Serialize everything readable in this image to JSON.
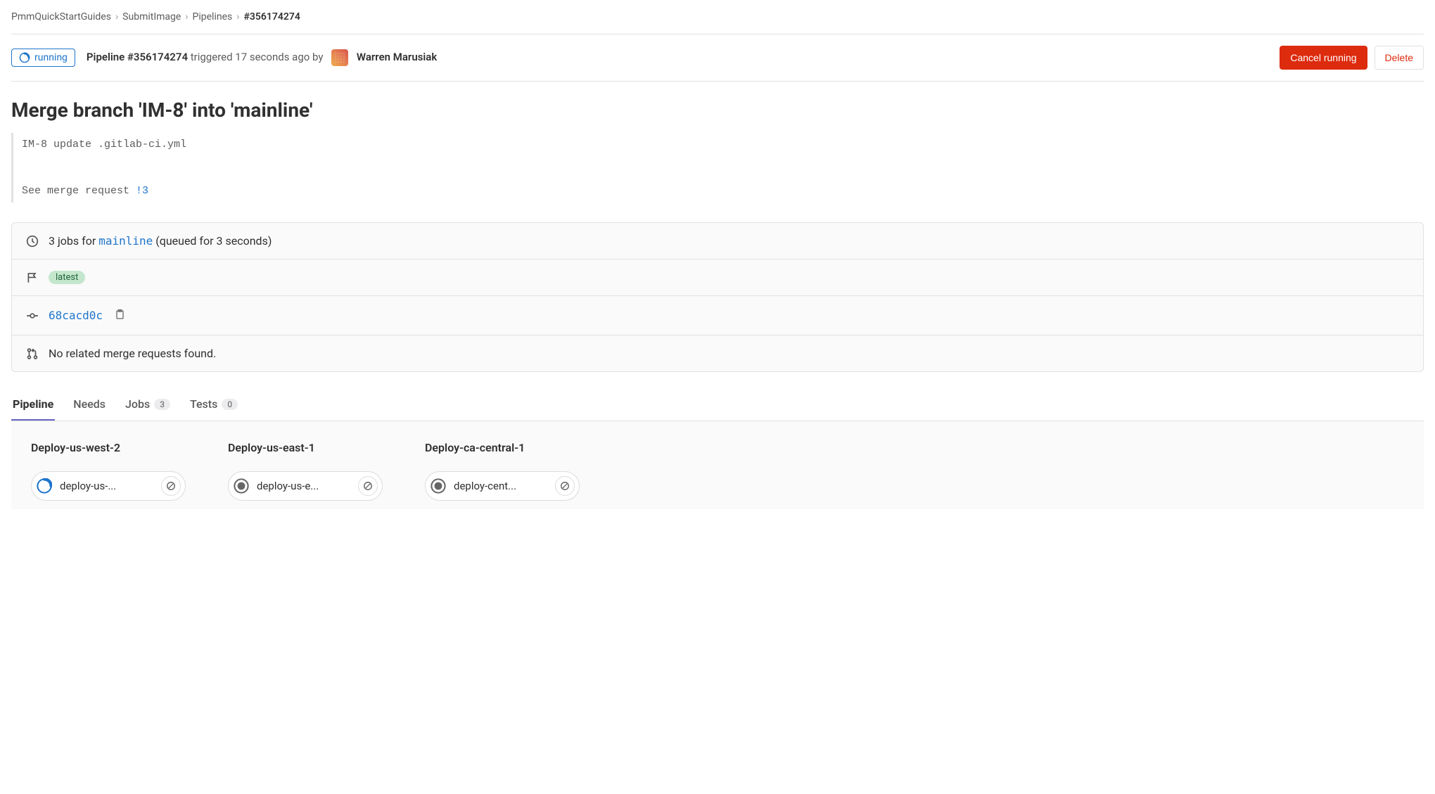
{
  "breadcrumb": [
    {
      "label": "PmmQuickStartGuides"
    },
    {
      "label": "SubmitImage"
    },
    {
      "label": "Pipelines"
    },
    {
      "label": "#356174274",
      "current": true
    }
  ],
  "header": {
    "status": "running",
    "pipeline_id": "Pipeline #356174274",
    "triggered_text": "triggered 17 seconds ago by",
    "author": "Warren Marusiak",
    "cancel_button": "Cancel running",
    "delete_button": "Delete"
  },
  "title": "Merge branch 'IM-8' into 'mainline'",
  "commit": {
    "line1": "IM-8 update .gitlab-ci.yml",
    "line2_prefix": "See merge request ",
    "mr_link": "!3"
  },
  "info": {
    "jobs": {
      "count": "3",
      "prefix": "jobs for",
      "branch": "mainline",
      "suffix": "(queued for 3 seconds)"
    },
    "latest_label": "latest",
    "commit_sha": "68cacd0c",
    "mr_text": "No related merge requests found."
  },
  "tabs": [
    {
      "label": "Pipeline",
      "active": true
    },
    {
      "label": "Needs"
    },
    {
      "label": "Jobs",
      "badge": "3"
    },
    {
      "label": "Tests",
      "badge": "0"
    }
  ],
  "stages": [
    {
      "name": "Deploy-us-west-2",
      "jobs": [
        {
          "name": "deploy-us-...",
          "status": "running"
        }
      ]
    },
    {
      "name": "Deploy-us-east-1",
      "jobs": [
        {
          "name": "deploy-us-e...",
          "status": "manual"
        }
      ]
    },
    {
      "name": "Deploy-ca-central-1",
      "jobs": [
        {
          "name": "deploy-cent...",
          "status": "manual"
        }
      ]
    }
  ]
}
